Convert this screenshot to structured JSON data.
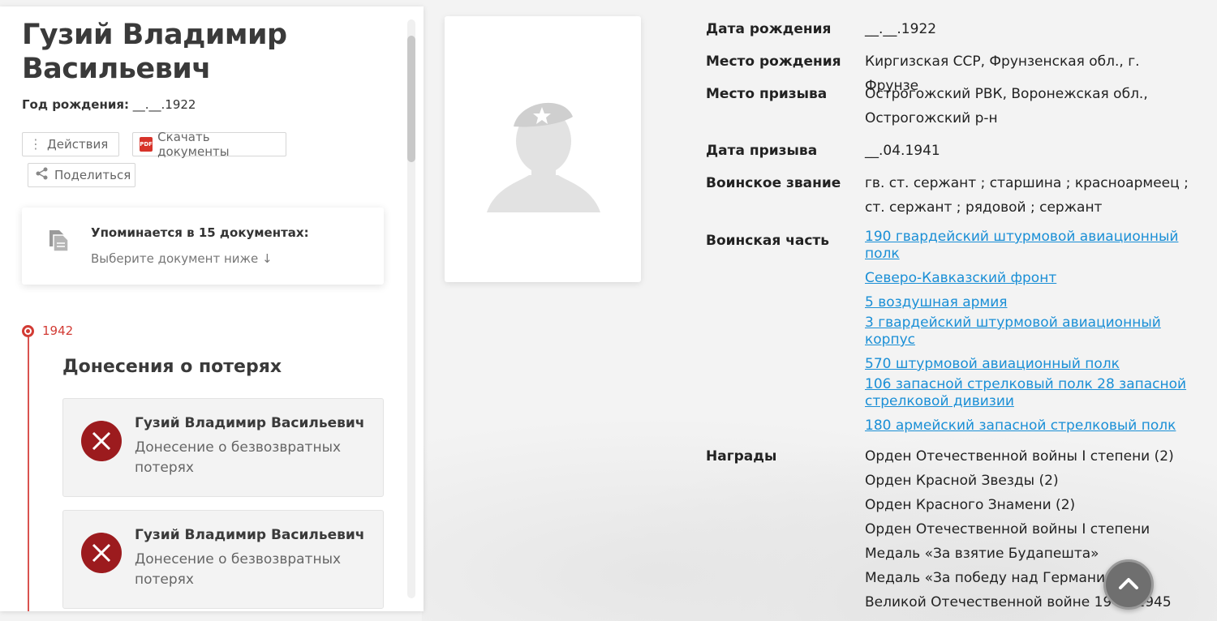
{
  "person": {
    "name": "Гузий Владимир Васильевич",
    "birth_year_label": "Год рождения:",
    "birth_year_value": "__.__.1922"
  },
  "actions": {
    "actions_label": "Действия",
    "download_label": "Скачать документы",
    "share_label": "Поделиться",
    "pdf_badge": "PDF"
  },
  "mentions": {
    "title": "Упоминается в 15 документах:",
    "subtitle": "Выберите документ ниже ↓"
  },
  "timeline": {
    "year": "1942",
    "section_title": "Донесения о потерях",
    "cards": [
      {
        "name": "Гузий Владимир Васильевич",
        "description": "Донесение о безвозвратных потерях"
      },
      {
        "name": "Гузий Владимир Васильевич",
        "description": "Донесение о безвозвратных потерях"
      }
    ]
  },
  "details": {
    "birth_date": {
      "label": "Дата рождения",
      "value": "__.__.1922"
    },
    "birth_place": {
      "label": "Место рождения",
      "value": "Киргизская ССР, Фрунзенская обл., г. Фрунзе"
    },
    "draft_place": {
      "label": "Место призыва",
      "value": "Острогожский РВК, Воронежская обл., Острогожский р-н"
    },
    "draft_date": {
      "label": "Дата призыва",
      "value": "__.04.1941"
    },
    "rank": {
      "label": "Воинское звание",
      "value": "гв. ст. сержант ; старшина ; красноармеец ; ст. сержант ; рядовой ; сержант"
    },
    "unit": {
      "label": "Воинская часть",
      "links": [
        "190 гвардейский штурмовой авиационный полк",
        "Северо-Кавказский фронт",
        "5 воздушная армия",
        "3 гвардейский штурмовой авиационный корпус",
        "570 штурмовой авиационный полк",
        "106 запасной стрелковый полк 28 запасной стрелковой дивизии",
        "180 армейский запасной стрелковый полк"
      ]
    },
    "awards": {
      "label": "Награды",
      "items": [
        "Орден Отечественной войны I степени (2)",
        "Орден Красной Звезды (2)",
        "Орден Красного Знамени (2)",
        "Орден Отечественной войны I степени",
        "Медаль «За взятие Будапешта»",
        "Медаль «За победу над Германией в Великой Отечественной войне 1941–1945"
      ]
    }
  },
  "colors": {
    "accent_red": "#d23b34",
    "loss_icon": "#9c1b1e",
    "link_blue": "#1a8fd6"
  },
  "icons": {
    "actions": "vertical-dots-icon",
    "download": "pdf-icon",
    "share": "share-icon",
    "mentions": "documents-icon",
    "loss": "cross-icon",
    "scroll_top": "chevron-up-icon"
  }
}
